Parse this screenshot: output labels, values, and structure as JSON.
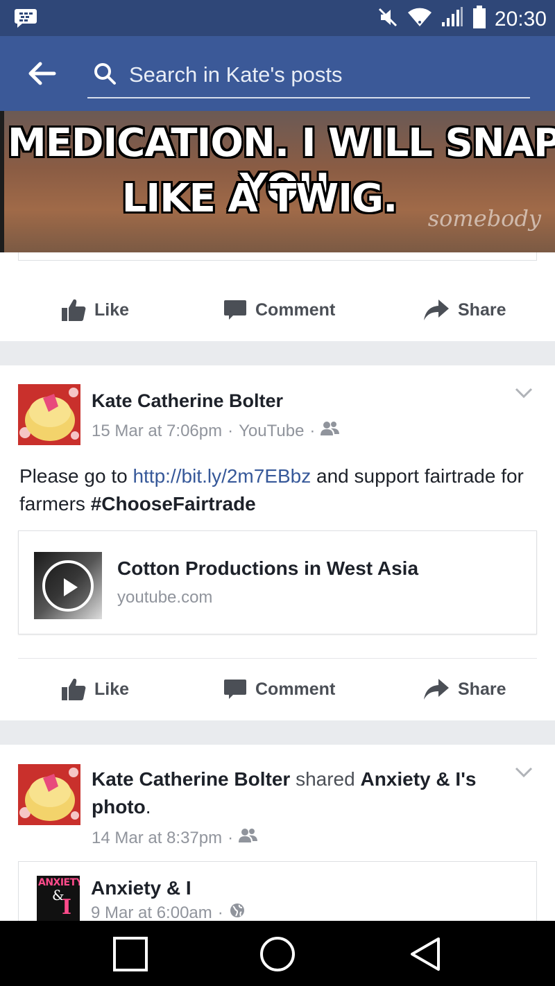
{
  "status_bar": {
    "time": "20:30",
    "icons": [
      "bbm-icon",
      "mute-icon",
      "wifi-icon",
      "signal-icon",
      "battery-icon"
    ]
  },
  "app_bar": {
    "back_icon": "arrow-left-icon",
    "search_placeholder": "Search in Kate's posts"
  },
  "meme": {
    "line1": "MEDICATION. I WILL SNAP YOU",
    "line2": "LIKE A TWIG.",
    "watermark": "somebody"
  },
  "actions": {
    "like": "Like",
    "comment": "Comment",
    "share": "Share"
  },
  "post2": {
    "author": "Kate Catherine Bolter",
    "date": "15 Mar at 7:06pm",
    "source": "YouTube",
    "text_pre": "Please go to ",
    "link": "http://bit.ly/2m7EBbz",
    "text_mid": " and support fairtrade for farmers ",
    "hashtag": "#ChooseFairtrade",
    "link_card": {
      "title": "Cotton Productions in West Asia",
      "domain": "youtube.com"
    }
  },
  "post3": {
    "author": "Kate Catherine Bolter",
    "shared_word": "shared",
    "page_name": "Anxiety & I's",
    "photo_word": "photo",
    "period": ".",
    "date": "14 Mar at 8:37pm",
    "shared_page": {
      "name": "Anxiety & I",
      "date": "9 Mar at 6:00am",
      "logo_text_1": "ANXIETY",
      "logo_text_2": "&",
      "logo_text_3": "I"
    }
  },
  "colors": {
    "facebook_blue": "#3b5998",
    "status_bar": "#2f4778",
    "link": "#365899",
    "meta_gray": "#90949c",
    "action_gray": "#4b4f56"
  }
}
